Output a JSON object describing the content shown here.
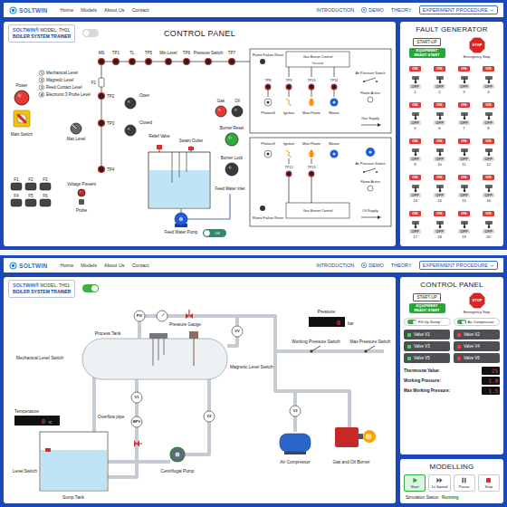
{
  "nav": {
    "logo": "SOLTWIN",
    "links": [
      "Home",
      "Models",
      "About Us",
      "Contact"
    ],
    "actions": [
      {
        "label": "INTRODUCTION",
        "kind": "link"
      },
      {
        "label": "DEMO",
        "kind": "demo"
      },
      {
        "label": "THEORY",
        "kind": "link"
      },
      {
        "label": "EXPERIMENT PROCEDURE",
        "kind": "dropdown"
      }
    ]
  },
  "badge": {
    "brand": "SOLTWIN®",
    "model": "MODEL: TH01",
    "subtitle": "BOILER SYSTEM TRAINER"
  },
  "control_screen": {
    "view_on": false,
    "title": "CONTROL PANEL",
    "terminals": [
      "MS",
      "TP1",
      "TL",
      "TP5",
      "Min Level",
      "TP6",
      "Pressure Switch",
      "TP7"
    ],
    "side_points": [
      "TP2",
      "TP3",
      "TP4"
    ],
    "fuse": "F1",
    "legend": [
      {
        "number": "1",
        "label": "Mechanical Level"
      },
      {
        "number": "2",
        "label": "Magnetic Level"
      },
      {
        "number": "3",
        "label": "Reed Contact Level"
      },
      {
        "number": "4",
        "label": "Electronic 3 Probe Level"
      }
    ],
    "lamps": [
      {
        "label": "Power",
        "lit": true,
        "color": "#e53935"
      },
      {
        "label": "Open",
        "lit": false
      },
      {
        "label": "Closed",
        "lit": false
      },
      {
        "label": "Gas",
        "lit": true,
        "color": "#e53935"
      },
      {
        "label": "Oil",
        "lit": false
      },
      {
        "label": "Burner Reset",
        "lit": true,
        "color": "#2eaa3f"
      },
      {
        "label": "Burner Lock",
        "lit": false
      },
      {
        "label": "Voltage Present",
        "lit": true,
        "color": "#c62828"
      }
    ],
    "labels": [
      "Main Switch",
      "Max Level",
      "Probe",
      "Relief Valve",
      "Steam Outlet",
      "Feed Water Inlet",
      "Feed Water Pump"
    ],
    "fuses": [
      "F1",
      "F2",
      "F3",
      "F4",
      "F5",
      "F6"
    ],
    "pump_toggle": {
      "label": "Off",
      "on": false
    },
    "gas_control": {
      "title": "Gas Burner Control",
      "subtitle": "Seconds",
      "reset": "Flame Failure Reset",
      "test_points": [
        "TP8",
        "TP9",
        "TP10",
        "TP11"
      ],
      "devices": [
        {
          "label": "Photocell",
          "kind": "photocell"
        },
        {
          "label": "Ignition",
          "kind": "ignition"
        },
        {
          "label": "Main Flame",
          "kind": "flame"
        },
        {
          "label": "Blower",
          "kind": "blower"
        }
      ],
      "air_switch": "Air Pressure Switch",
      "flame_active": "Flame Active",
      "supply": "Gas Supply"
    },
    "oil_control": {
      "title": "Gas Burner Control",
      "reset": "Flame Failure Reset",
      "test_points": [
        "TP12",
        "TP13"
      ],
      "devices": [
        {
          "label": "Photocell",
          "kind": "photocell"
        },
        {
          "label": "Ignition",
          "kind": "ignition"
        },
        {
          "label": "Main Flame",
          "kind": "flame"
        },
        {
          "label": "Blower",
          "kind": "blower"
        }
      ],
      "air_switch": "Air Pressure Switch",
      "flame_active": "Flame Active",
      "supply": "Oil Supply"
    }
  },
  "fault_generator": {
    "title": "FAULT GENERATOR",
    "startup": {
      "label": "START-UP",
      "ready": "EQUIPMENT READY START",
      "stop": "STOP",
      "emergency": "Emergency Stop"
    },
    "on_label": "ON",
    "off_label": "OFF",
    "switches": [
      {
        "number": "1",
        "on": false
      },
      {
        "number": "2",
        "on": false
      },
      {
        "number": "3",
        "on": false
      },
      {
        "number": "4",
        "on": false
      },
      {
        "number": "5",
        "on": false
      },
      {
        "number": "6",
        "on": false
      },
      {
        "number": "7",
        "on": false
      },
      {
        "number": "8",
        "on": false
      },
      {
        "number": "9",
        "on": false
      },
      {
        "number": "10",
        "on": false
      },
      {
        "number": "11",
        "on": false
      },
      {
        "number": "12",
        "on": false
      },
      {
        "number": "13",
        "on": false
      },
      {
        "number": "14",
        "on": false
      },
      {
        "number": "15",
        "on": false
      },
      {
        "number": "16",
        "on": false
      },
      {
        "number": "17",
        "on": false
      },
      {
        "number": "18",
        "on": false
      },
      {
        "number": "19",
        "on": false
      },
      {
        "number": "20",
        "on": false
      }
    ]
  },
  "process_screen": {
    "view_on": true,
    "instruments": [
      "PIV",
      "VV",
      "V1",
      "BPV",
      "V2",
      "V3"
    ],
    "labels": [
      "Pressure Gauge",
      "Process Tank",
      "Mechanical Level Switch",
      "Magnetic Level Switch",
      "Centrifugal Pump",
      "Overflow pipe",
      "Level Switch",
      "Sump Tank",
      "Working Pressure Switch",
      "Max Pressure Switch",
      "Air Compressor",
      "Gas and Oil Burner"
    ],
    "temperature": {
      "label": "Temperature",
      "value": "0",
      "unit": "°C"
    },
    "pressure": {
      "label": "Pressure:",
      "value": "0",
      "unit": "bar"
    }
  },
  "control_panel": {
    "title": "CONTROL PANEL",
    "startup": {
      "label": "START-UP",
      "ready": "EQUIPMENT READY START",
      "stop": "STOP",
      "emergency": "Emergency Stop"
    },
    "toggles": [
      {
        "label": "Fill Up Sump",
        "on": true
      },
      {
        "label": "Air Compressor",
        "on": true
      }
    ],
    "valves": [
      {
        "label": "Valve V1",
        "open": true
      },
      {
        "label": "Valve V2",
        "open": false
      },
      {
        "label": "Valve V3",
        "open": true
      },
      {
        "label": "Valve V4",
        "open": false
      },
      {
        "label": "Valve V5",
        "open": true
      },
      {
        "label": "Valve V6",
        "open": false
      }
    ],
    "readings": [
      {
        "label": "Thermostat Value:",
        "value": "25"
      },
      {
        "label": "Working Pressure:",
        "value": "1.0"
      },
      {
        "label": "Max Working Pressure:",
        "value": "1.5"
      }
    ]
  },
  "modelling": {
    "title": "MODELLING",
    "buttons": [
      {
        "label": "Start",
        "kind": "start",
        "selected": true
      },
      {
        "label": "1x Speed",
        "kind": "speed",
        "selected": false
      },
      {
        "label": "Pause",
        "kind": "pause",
        "selected": false
      },
      {
        "label": "Stop",
        "kind": "stop",
        "selected": false
      }
    ],
    "status_label": "Simulation Status:",
    "status": "Running"
  }
}
